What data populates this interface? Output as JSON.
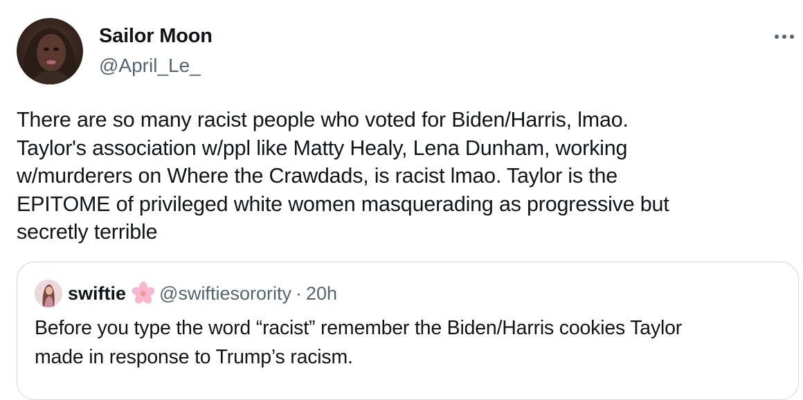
{
  "tweet": {
    "author": {
      "display_name": "Sailor Moon",
      "handle": "@April_Le_",
      "avatar_icon": "profile-photo"
    },
    "more_icon": "more-horizontal-icon",
    "text": "There are so many racist people who voted for Biden/Harris, lmao.\nTaylor's association w/ppl like Matty Healy, Lena Dunham, working\nw/murderers on Where the Crawdads, is racist lmao. Taylor is the\nEPITOME of privileged white women masquerading as progressive but\nsecretly terrible"
  },
  "quoted_tweet": {
    "author": {
      "display_name": "swiftie",
      "emoji_icon": "cherry-blossom-icon",
      "handle": "@swiftiesorority",
      "separator": "·",
      "time": "20h"
    },
    "text": "Before you type the word “racist” remember the Biden/Harris cookies Taylor\nmade in response to Trump’s racism."
  },
  "colors": {
    "text_primary": "#0f1419",
    "text_secondary": "#536471",
    "border": "#cfd9de"
  }
}
